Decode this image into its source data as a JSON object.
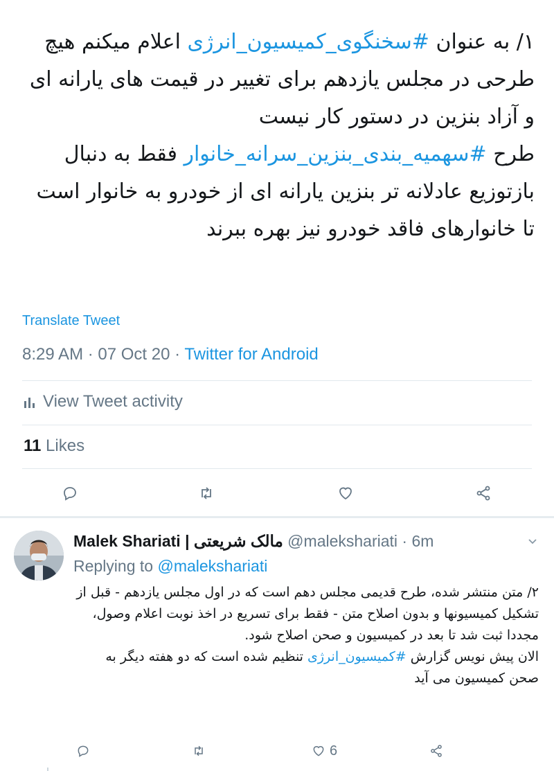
{
  "main_tweet": {
    "line1_prefix": "۱/ به عنوان ",
    "line1_hashtag": "#سخنگوی_کمیسیون_انرژی",
    "line1_suffix": " اعلام میکنم هیچ طرحی در مجلس یازدهم برای تغییر در قیمت های یارانه ای و آزاد بنزین در دستور کار نیست",
    "line2_prefix": "طرح ",
    "line2_hashtag": "#سهمیه_بندی_بنزین_سرانه_خانوار",
    "line2_suffix": " فقط به دنبال بازتوزیع عادلانه تر بنزین یارانه ای از خودرو به خانوار است تا خانوارهای فاقد خودرو نیز بهره ببرند",
    "translate_label": "Translate Tweet",
    "timestamp": "8:29 AM · 07 Oct 20 · ",
    "source": "Twitter for Android",
    "activity_label": "View Tweet activity",
    "likes_count": "11",
    "likes_label": " Likes"
  },
  "reply": {
    "name": "Malek Shariati | مالک شریعتی",
    "handle": " @malekshariati · 6m",
    "replying_prefix": "Replying to ",
    "replying_handle": "@malekshariati",
    "text_line1": "۲/ متن منتشر شده، طرح قدیمی مجلس دهم است که در اول مجلس یازدهم - قبل از تشکیل کمیسیونها و بدون اصلاح متن - فقط برای تسریع در اخذ نوبت اعلام وصول، مجددا ثبت شد تا بعد در کمیسیون و صحن اصلاح شود.",
    "text_line2_prefix": "الان پیش نویس گزارش ",
    "text_line2_hashtag": "#کمیسیون_انرژی",
    "text_line2_suffix": " تنظیم شده است که دو هفته دیگر به صحن کمیسیون می آید",
    "like_count": "6"
  },
  "icons": {
    "reply": "reply-icon",
    "retweet": "retweet-icon",
    "like": "heart-icon",
    "share": "share-icon",
    "activity": "bar-chart-icon",
    "menu": "chevron-down-icon"
  },
  "colors": {
    "accent": "#1b95e0",
    "secondary_text": "#657786",
    "primary_text": "#14171a"
  }
}
